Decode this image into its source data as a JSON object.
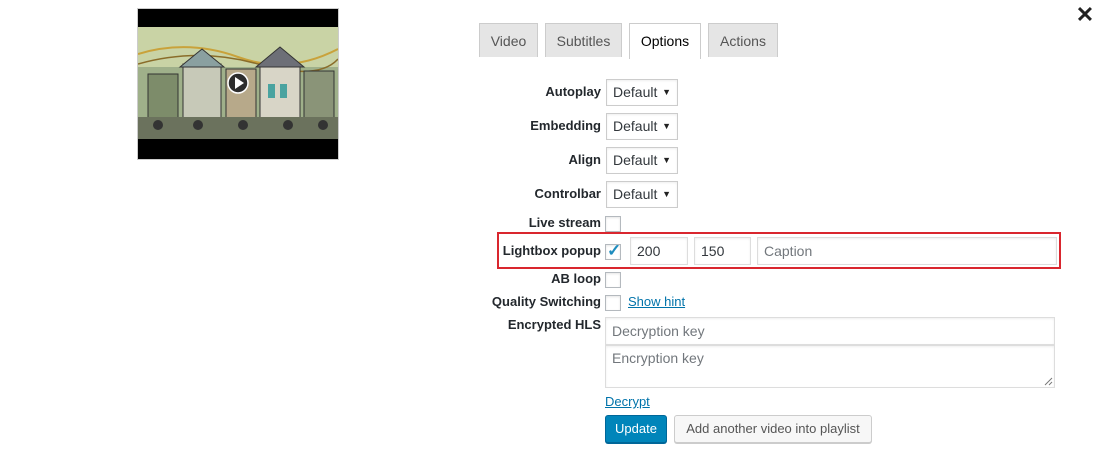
{
  "dialog": {
    "close_icon": "close-icon"
  },
  "preview": {
    "icon": "video-thumbnail-image",
    "play_icon": "play-icon"
  },
  "tabs": [
    {
      "label": "Video",
      "active": false
    },
    {
      "label": "Subtitles",
      "active": false
    },
    {
      "label": "Options",
      "active": true
    },
    {
      "label": "Actions",
      "active": false
    }
  ],
  "options": {
    "autoplay": {
      "label": "Autoplay",
      "value": "Default"
    },
    "embedding": {
      "label": "Embedding",
      "value": "Default"
    },
    "align": {
      "label": "Align",
      "value": "Default"
    },
    "controlbar": {
      "label": "Controlbar",
      "value": "Default"
    },
    "live_stream": {
      "label": "Live stream",
      "checked": false
    },
    "lightbox_popup": {
      "label": "Lightbox popup",
      "checked": true,
      "width": "200",
      "height": "150",
      "caption_placeholder": "Caption"
    },
    "ab_loop": {
      "label": "AB loop",
      "checked": false
    },
    "quality_switching": {
      "label": "Quality Switching",
      "checked": false,
      "hint_link": "Show hint"
    },
    "encrypted_hls": {
      "label": "Encrypted HLS",
      "decryption_placeholder": "Decryption key",
      "encryption_placeholder": "Encryption key",
      "decrypt_link": "Decrypt"
    }
  },
  "actions": {
    "update_label": "Update",
    "add_video_label": "Add another video into playlist"
  },
  "colors": {
    "accent": "#0085ba",
    "highlight_border": "#d9262e",
    "link": "#0073aa"
  }
}
